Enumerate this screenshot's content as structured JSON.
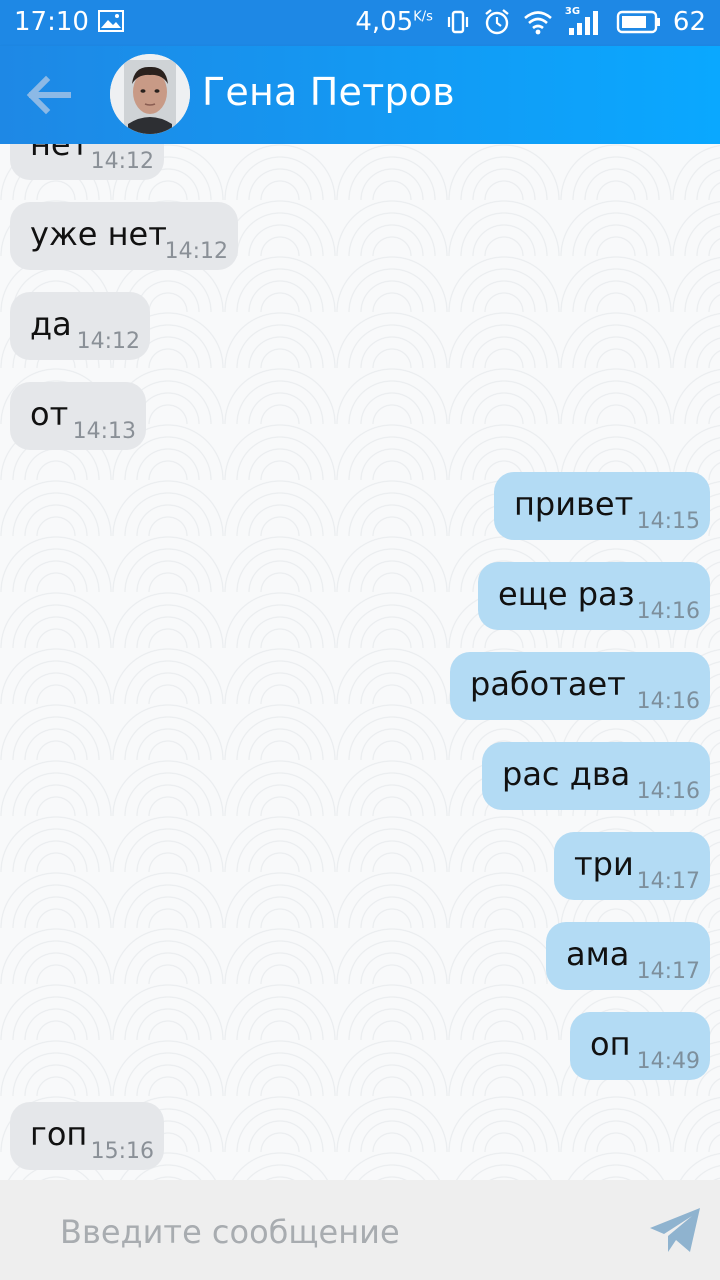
{
  "status_bar": {
    "time": "17:10",
    "speed": "4,05",
    "speed_unit": "K/s",
    "network": "3G",
    "battery": "62",
    "icons": [
      "gallery-icon",
      "vibrate-icon",
      "alarm-icon",
      "wifi-icon",
      "signal-icon",
      "battery-icon"
    ]
  },
  "header": {
    "contact_name": "Гена Петров",
    "back_icon": "arrow-left-icon",
    "avatar": "avatar"
  },
  "messages": [
    {
      "direction": "in",
      "text": "нет",
      "time": "14:12"
    },
    {
      "direction": "in",
      "text": "уже нет",
      "time": "14:12"
    },
    {
      "direction": "in",
      "text": "да",
      "time": "14:12"
    },
    {
      "direction": "in",
      "text": "от",
      "time": "14:13"
    },
    {
      "direction": "out",
      "text": "привет",
      "time": "14:15"
    },
    {
      "direction": "out",
      "text": "еще раз",
      "time": "14:16"
    },
    {
      "direction": "out",
      "text": "работает",
      "time": "14:16"
    },
    {
      "direction": "out",
      "text": "рас два",
      "time": "14:16"
    },
    {
      "direction": "out",
      "text": "три",
      "time": "14:17"
    },
    {
      "direction": "out",
      "text": "ама",
      "time": "14:17"
    },
    {
      "direction": "out",
      "text": "оп",
      "time": "14:49"
    },
    {
      "direction": "in",
      "text": "гоп",
      "time": "15:16"
    }
  ],
  "composer": {
    "placeholder": "Введите сообщение",
    "value": "",
    "send_icon": "send-icon"
  },
  "colors": {
    "header": "#1e88e5",
    "incoming_bubble": "#e5e7ea",
    "outgoing_bubble": "#b3dbf4"
  }
}
